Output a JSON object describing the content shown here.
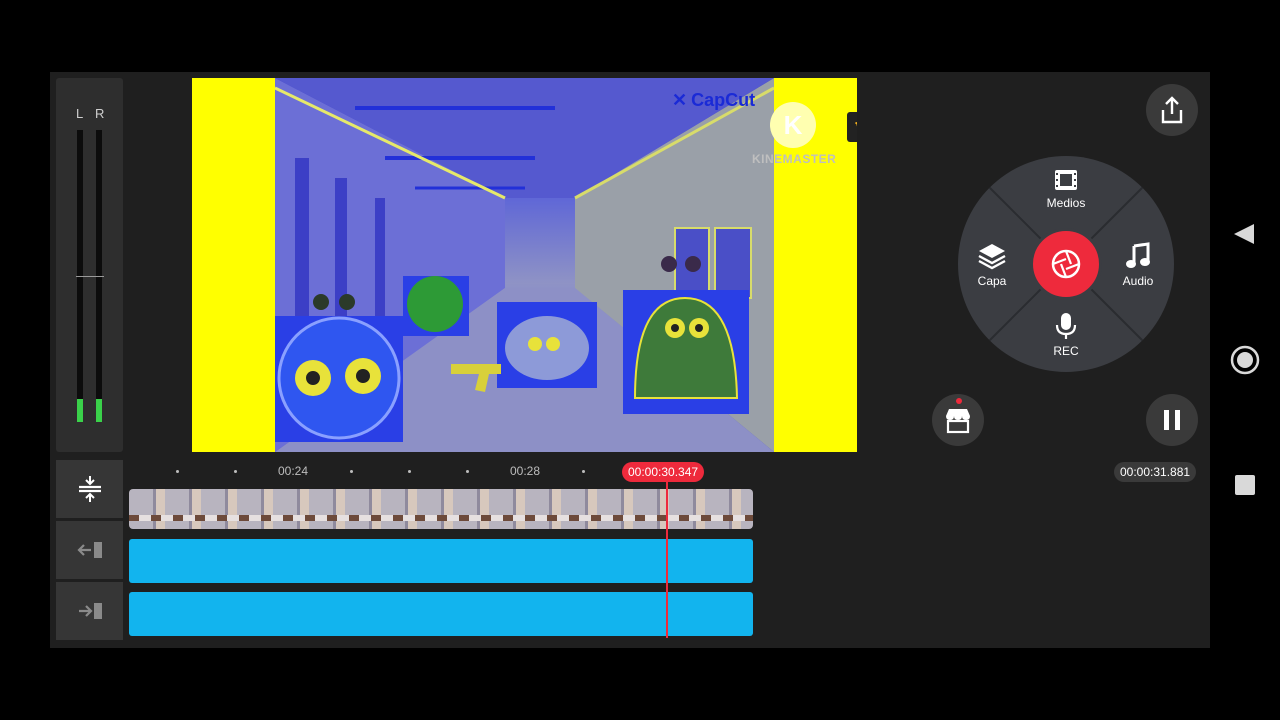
{
  "meter": {
    "left_label": "L",
    "right_label": "R",
    "left_level": 0.08,
    "right_level": 0.08
  },
  "preview": {
    "watermark_capcut": "CapCut",
    "watermark_kinemaster": "KINEMASTER"
  },
  "controls": {
    "wheel": {
      "media_label": "Medios",
      "layer_label": "Capa",
      "audio_label": "Audio",
      "rec_label": "REC"
    }
  },
  "timeline": {
    "ticks": [
      "00:24",
      "00:28"
    ],
    "current_time": "00:00:30.347",
    "total_time": "00:00:31.881"
  },
  "colors": {
    "accent": "#ee2a3c",
    "audio_clip": "#12b4ee",
    "meter": "#3ad14a",
    "preview_bg": "#ffff00"
  }
}
